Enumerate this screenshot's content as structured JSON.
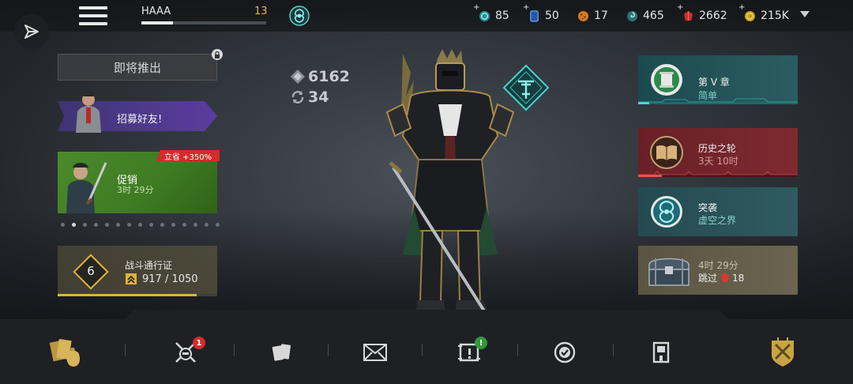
{
  "player": {
    "name": "HAAA",
    "level": "13",
    "xp_fraction": 0.25
  },
  "currencies": [
    {
      "name": "energy",
      "icon": "energy-orb-icon",
      "value": "85",
      "color": "#3fb8c0"
    },
    {
      "name": "cards",
      "icon": "card-icon",
      "value": "50",
      "color": "#3a7ad8"
    },
    {
      "name": "coins-orange",
      "icon": "cookie-icon",
      "value": "17",
      "color": "#e08a2a"
    },
    {
      "name": "spiral",
      "icon": "spiral-orb-icon",
      "value": "465",
      "color": "#4aa7b8"
    },
    {
      "name": "rubies",
      "icon": "ruby-icon",
      "value": "2662",
      "color": "#d43a30"
    },
    {
      "name": "gold",
      "icon": "gold-coin-icon",
      "value": "215K",
      "color": "#d8a82a"
    }
  ],
  "left": {
    "coming_soon": "即将推出",
    "invite": "招募好友!",
    "promo": {
      "badge": "立省 +350%",
      "title": "促销",
      "time": "3时 29分"
    },
    "carousel": {
      "count": 15,
      "active": 1
    },
    "battlepass": {
      "level": "6",
      "title": "战斗通行证",
      "xp": "917 / 1050",
      "progress": 0.873
    }
  },
  "hero": {
    "power": "6162",
    "upgrades": "34"
  },
  "right": {
    "chapter": {
      "title": "第 V 章",
      "subtitle": "简单"
    },
    "history": {
      "title": "历史之轮",
      "subtitle": "3天 10时"
    },
    "raid": {
      "title": "突袭",
      "subtitle": "虚空之界"
    },
    "chest": {
      "time": "4时 29分",
      "skip": "跳过",
      "cost": "18"
    }
  },
  "nav": {
    "badges": {
      "battle": "1",
      "events": "!"
    }
  },
  "colors": {
    "gold": "#e0b43a",
    "teal": "#2fb0b0",
    "badge_red": "#d42b2b",
    "badge_green": "#2f9a3a"
  }
}
